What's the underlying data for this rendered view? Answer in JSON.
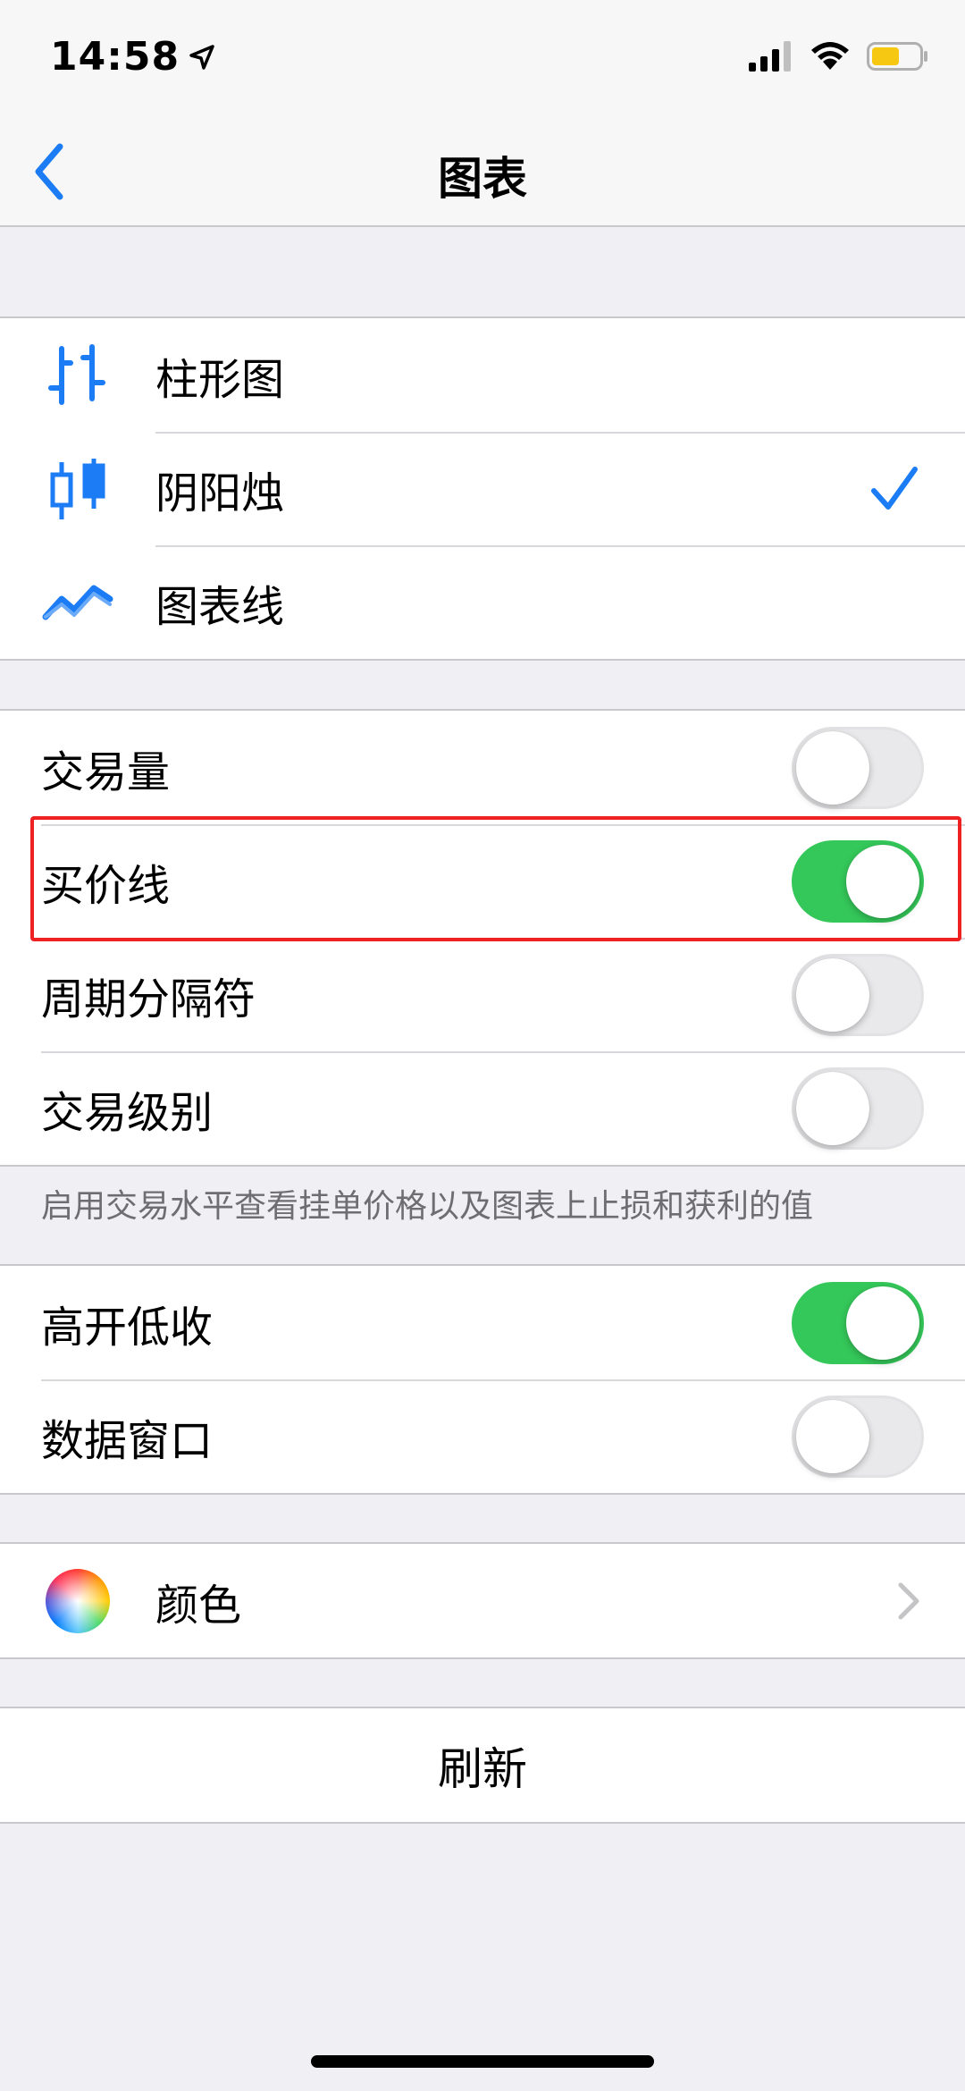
{
  "status_bar": {
    "time": "14:58"
  },
  "nav": {
    "title": "图表"
  },
  "chart_type": {
    "items": [
      {
        "label": "柱形图",
        "icon": "bar-chart-icon",
        "selected": false
      },
      {
        "label": "阴阳烛",
        "icon": "candlestick-icon",
        "selected": true
      },
      {
        "label": "图表线",
        "icon": "line-chart-icon",
        "selected": false
      }
    ]
  },
  "display_options": {
    "items": [
      {
        "label": "交易量",
        "on": false
      },
      {
        "label": "买价线",
        "on": true
      },
      {
        "label": "周期分隔符",
        "on": false
      },
      {
        "label": "交易级别",
        "on": false
      }
    ],
    "footnote": "启用交易水平查看挂单价格以及图表上止损和获利的值"
  },
  "extra_options": {
    "items": [
      {
        "label": "高开低收",
        "on": true
      },
      {
        "label": "数据窗口",
        "on": false
      }
    ]
  },
  "color_row": {
    "label": "颜色",
    "icon": "color-wheel-icon"
  },
  "refresh": {
    "label": "刷新"
  },
  "colors": {
    "accent": "#1b7cf5",
    "toggle_on": "#34c759",
    "highlight": "#ee2222"
  }
}
